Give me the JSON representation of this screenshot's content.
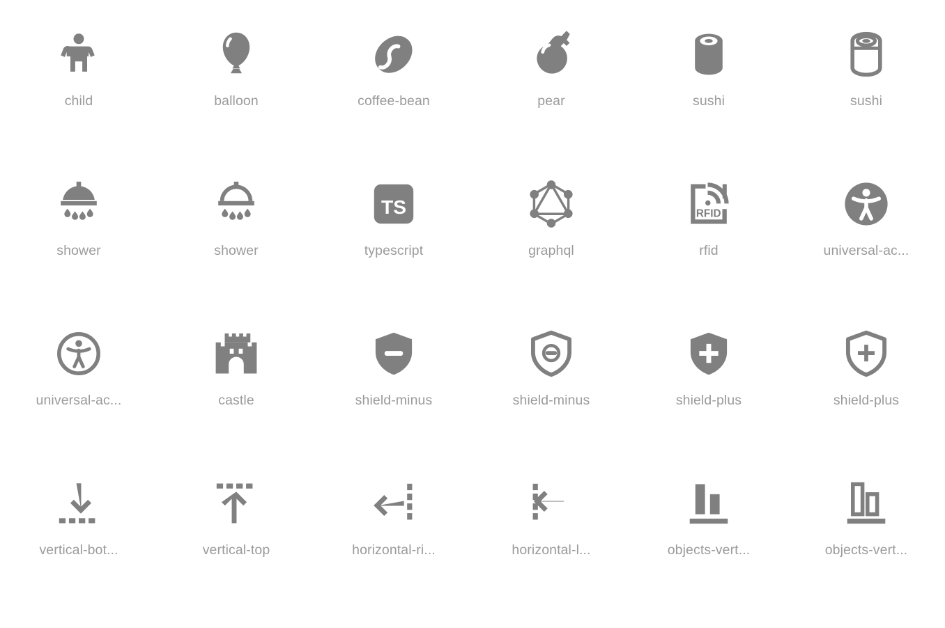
{
  "page": {
    "background_color": "#ffffff",
    "icon_color": "#808080",
    "label_color": "#9b9b9b",
    "columns": 6,
    "rows": 4
  },
  "icons": [
    {
      "name": "child",
      "label": "child",
      "glyph": "child",
      "style": "filled"
    },
    {
      "name": "balloon",
      "label": "balloon",
      "glyph": "balloon",
      "style": "filled"
    },
    {
      "name": "coffee-bean",
      "label": "coffee-bean",
      "glyph": "coffee-bean",
      "style": "filled"
    },
    {
      "name": "pear",
      "label": "pear",
      "glyph": "pear",
      "style": "filled"
    },
    {
      "name": "sushi-filled",
      "label": "sushi",
      "glyph": "sushi",
      "style": "filled"
    },
    {
      "name": "sushi-outline",
      "label": "sushi",
      "glyph": "sushi",
      "style": "outline"
    },
    {
      "name": "shower-filled",
      "label": "shower",
      "glyph": "shower",
      "style": "filled"
    },
    {
      "name": "shower-outline",
      "label": "shower",
      "glyph": "shower",
      "style": "outline"
    },
    {
      "name": "typescript",
      "label": "typescript",
      "glyph": "typescript",
      "style": "filled"
    },
    {
      "name": "graphql",
      "label": "graphql",
      "glyph": "graphql",
      "style": "outline"
    },
    {
      "name": "rfid",
      "label": "rfid",
      "glyph": "rfid",
      "style": "outline"
    },
    {
      "name": "universal-access-filled",
      "label": "universal-ac...",
      "glyph": "universal-access",
      "style": "filled"
    },
    {
      "name": "universal-access-outline",
      "label": "universal-ac...",
      "glyph": "universal-access",
      "style": "outline"
    },
    {
      "name": "castle",
      "label": "castle",
      "glyph": "castle",
      "style": "filled"
    },
    {
      "name": "shield-minus-filled",
      "label": "shield-minus",
      "glyph": "shield-minus",
      "style": "filled"
    },
    {
      "name": "shield-minus-outline",
      "label": "shield-minus",
      "glyph": "shield-minus",
      "style": "outline"
    },
    {
      "name": "shield-plus-filled",
      "label": "shield-plus",
      "glyph": "shield-plus",
      "style": "filled"
    },
    {
      "name": "shield-plus-outline",
      "label": "shield-plus",
      "glyph": "shield-plus",
      "style": "outline"
    },
    {
      "name": "align-vertical-bottom",
      "label": "vertical-bot...",
      "glyph": "align-vertical-bottom",
      "style": "filled"
    },
    {
      "name": "align-vertical-top",
      "label": "vertical-top",
      "glyph": "align-vertical-top",
      "style": "outline"
    },
    {
      "name": "align-horizontal-right",
      "label": "horizontal-ri...",
      "glyph": "align-horizontal-right",
      "style": "filled"
    },
    {
      "name": "align-horizontal-left",
      "label": "horizontal-l...",
      "glyph": "align-horizontal-left",
      "style": "outline"
    },
    {
      "name": "objects-vertical-bottom-filled",
      "label": "objects-vert...",
      "glyph": "objects-vertical-bottom",
      "style": "filled"
    },
    {
      "name": "objects-vertical-bottom-outline",
      "label": "objects-vert...",
      "glyph": "objects-vertical-bottom",
      "style": "outline"
    }
  ]
}
